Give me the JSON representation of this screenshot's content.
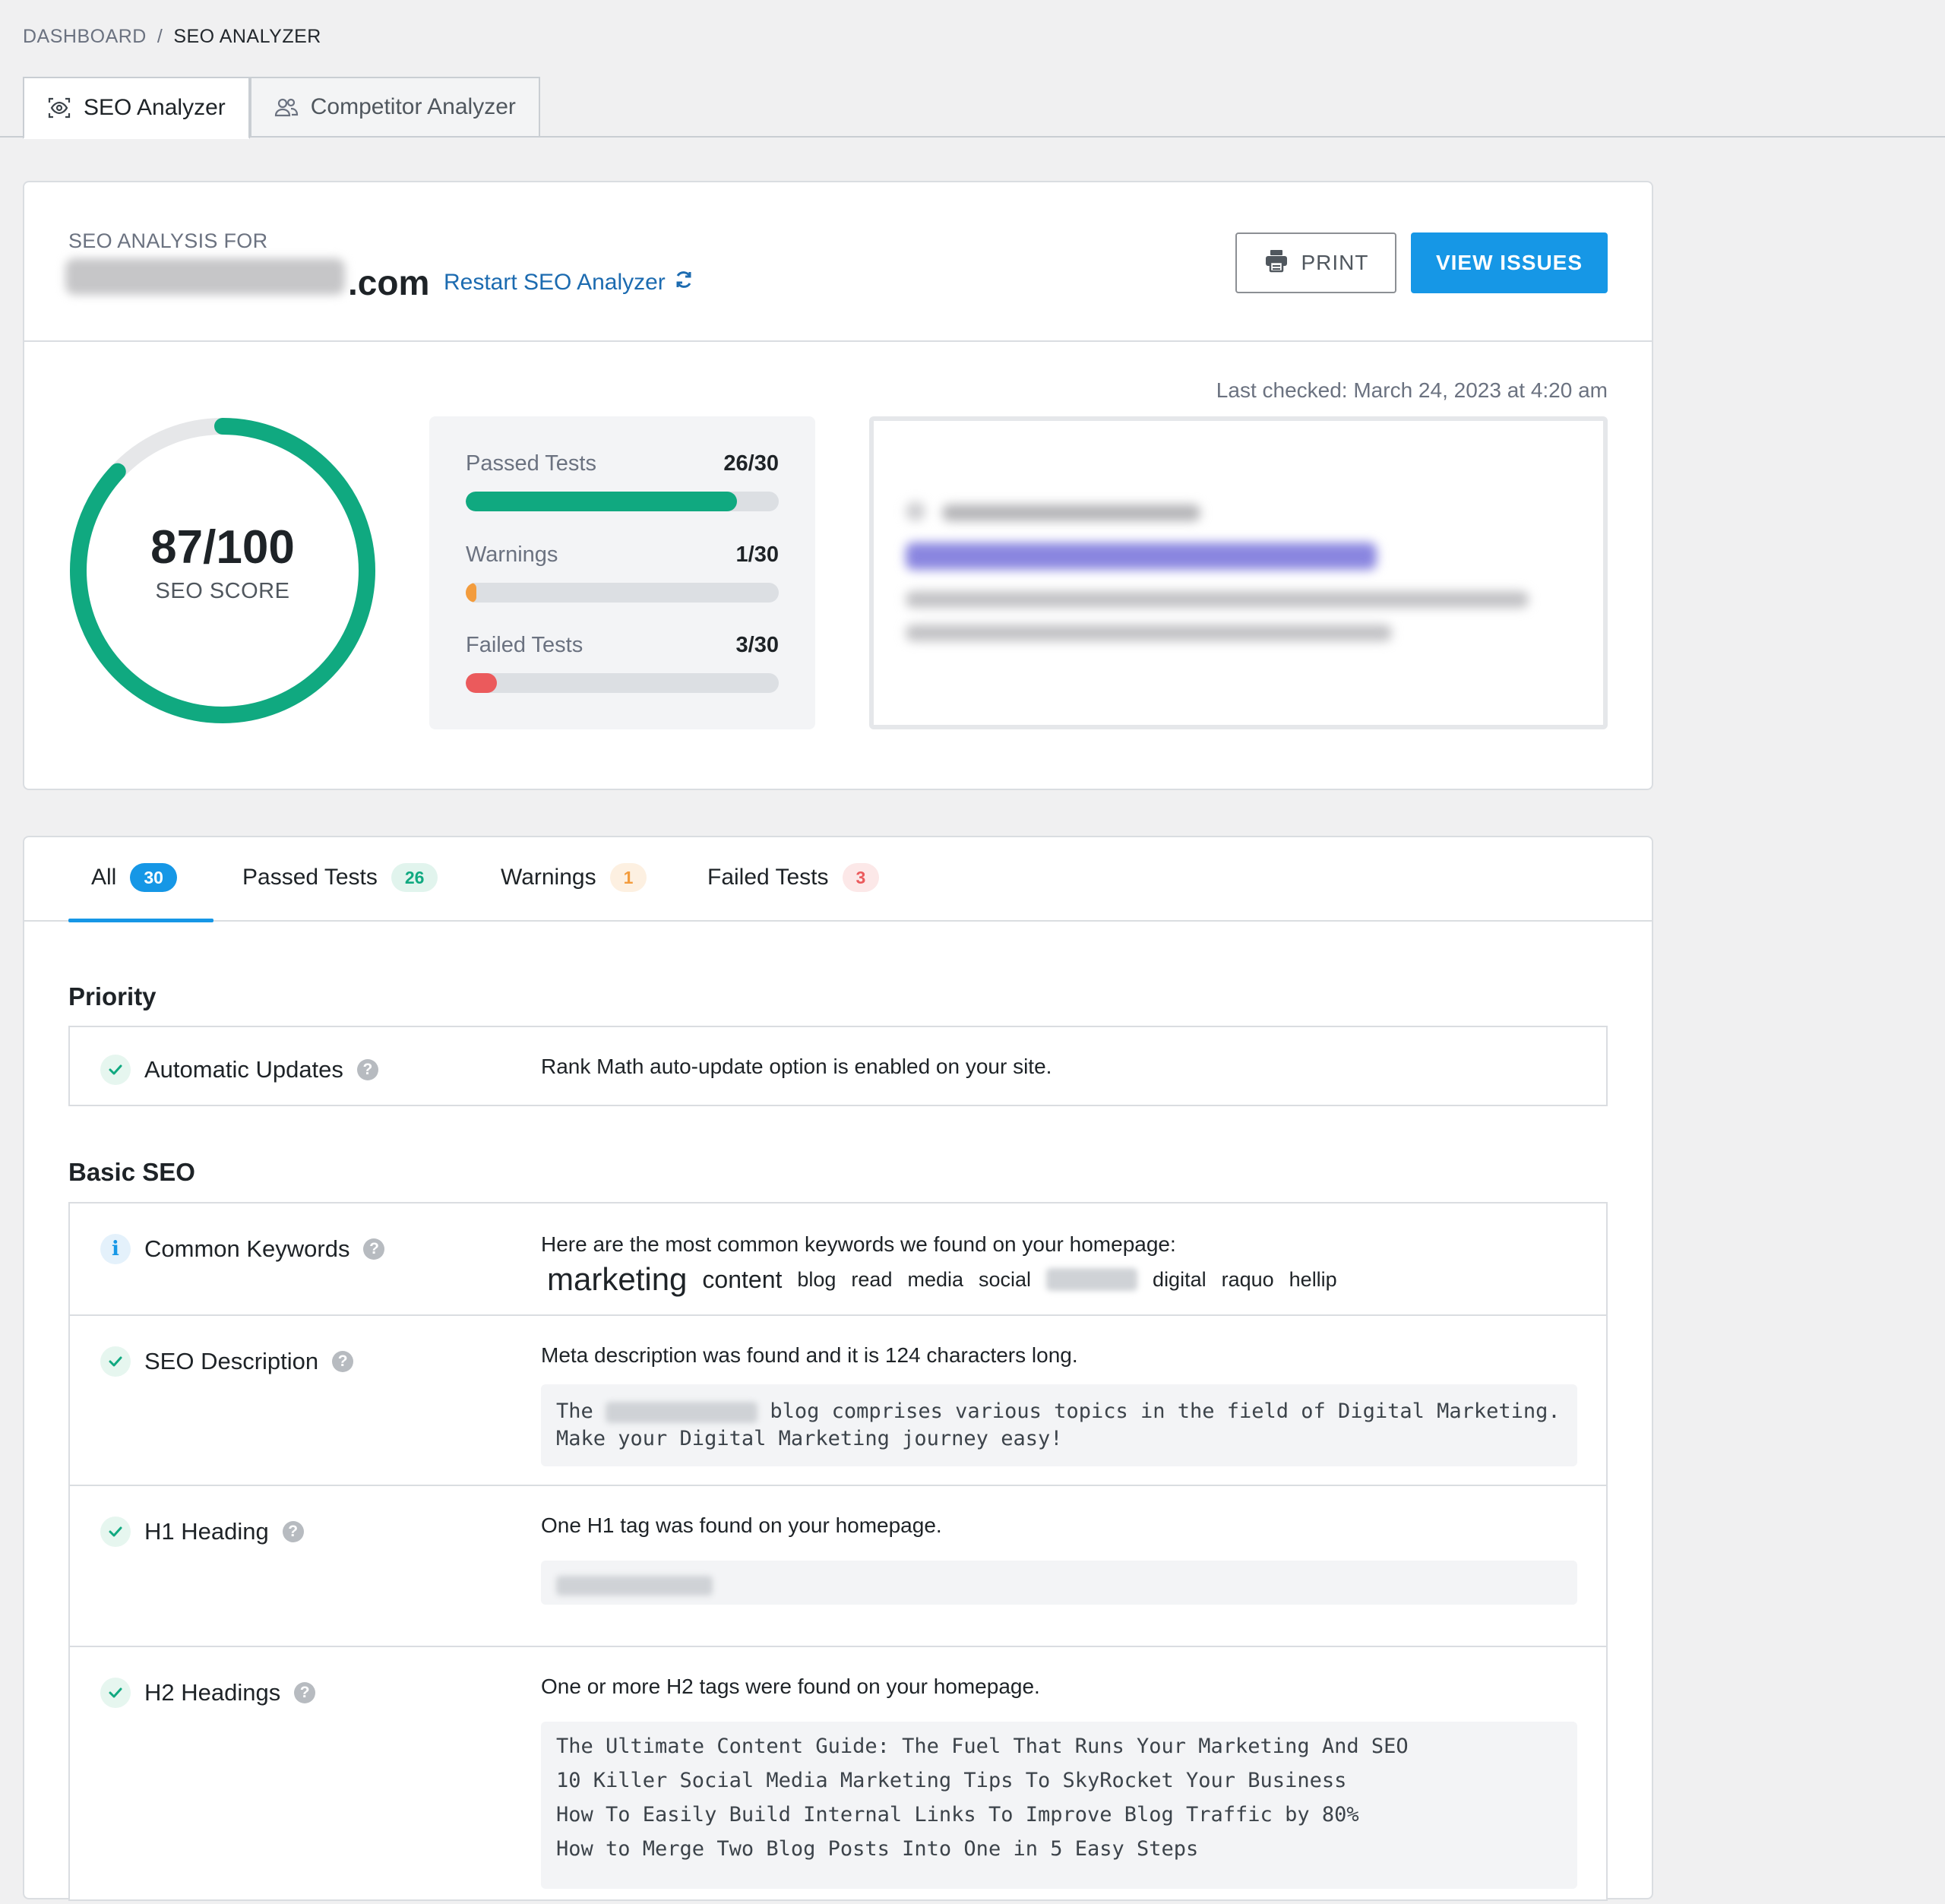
{
  "breadcrumb": {
    "parent": "DASHBOARD",
    "separator": "/",
    "current": "SEO ANALYZER"
  },
  "top_tabs": [
    {
      "label": "SEO Analyzer",
      "icon": "eye-scan-icon",
      "active": true
    },
    {
      "label": "Competitor Analyzer",
      "icon": "users-icon",
      "active": false
    }
  ],
  "header": {
    "analysis_for_label": "SEO ANALYSIS FOR",
    "domain_tld": ".com",
    "restart_label": "Restart SEO Analyzer",
    "print_label": "PRINT",
    "view_issues_label": "VIEW ISSUES"
  },
  "summary": {
    "last_checked": "Last checked: March 24, 2023 at 4:20 am",
    "score_value": "87/100",
    "score_label": "SEO SCORE",
    "score_fraction": 0.87,
    "passed": {
      "label": "Passed Tests",
      "value": "26/30",
      "fraction": 0.867,
      "color": "#10a980"
    },
    "warnings": {
      "label": "Warnings",
      "value": "1/30",
      "fraction": 0.033,
      "color": "#f39c3d"
    },
    "failed": {
      "label": "Failed Tests",
      "value": "3/30",
      "fraction": 0.1,
      "color": "#eb5a5c"
    }
  },
  "filter_tabs": [
    {
      "label": "All",
      "count": "30",
      "badge_bg": "#1697e6",
      "badge_fg": "#ffffff"
    },
    {
      "label": "Passed Tests",
      "count": "26",
      "badge_bg": "#e1f4ed",
      "badge_fg": "#10a980"
    },
    {
      "label": "Warnings",
      "count": "1",
      "badge_bg": "#fdf0e1",
      "badge_fg": "#f39c3d"
    },
    {
      "label": "Failed Tests",
      "count": "3",
      "badge_bg": "#fce8e8",
      "badge_fg": "#eb5a5c"
    }
  ],
  "sections": {
    "priority": {
      "title": "Priority",
      "tests": [
        {
          "name": "Automatic Updates",
          "status": "pass",
          "message": "Rank Math auto-update option is enabled on your site."
        }
      ]
    },
    "basic_seo": {
      "title": "Basic SEO",
      "common_keywords": {
        "name": "Common Keywords",
        "status": "info",
        "message": "Here are the most common keywords we found on your homepage:",
        "keywords": [
          "marketing",
          "content",
          "blog",
          "read",
          "media",
          "social",
          "digital",
          "raquo",
          "hellip"
        ]
      },
      "seo_description": {
        "name": "SEO Description",
        "status": "pass",
        "message": "Meta description was found and it is 124 characters long.",
        "code_prefix": "The",
        "code_line1_rest": "blog comprises various topics in the field of Digital Marketing.",
        "code_line2": "Make your Digital Marketing journey easy!"
      },
      "h1_heading": {
        "name": "H1 Heading",
        "status": "pass",
        "message": "One H1 tag was found on your homepage."
      },
      "h2_headings": {
        "name": "H2 Headings",
        "status": "pass",
        "message": "One or more H2 tags were found on your homepage.",
        "lines": [
          "The Ultimate Content Guide: The Fuel That Runs Your Marketing And SEO",
          "10 Killer Social Media Marketing Tips To SkyRocket Your Business",
          "How To Easily Build Internal Links To Improve Blog Traffic by 80%",
          "How to Merge Two Blog Posts Into One in 5 Easy Steps"
        ]
      }
    }
  }
}
